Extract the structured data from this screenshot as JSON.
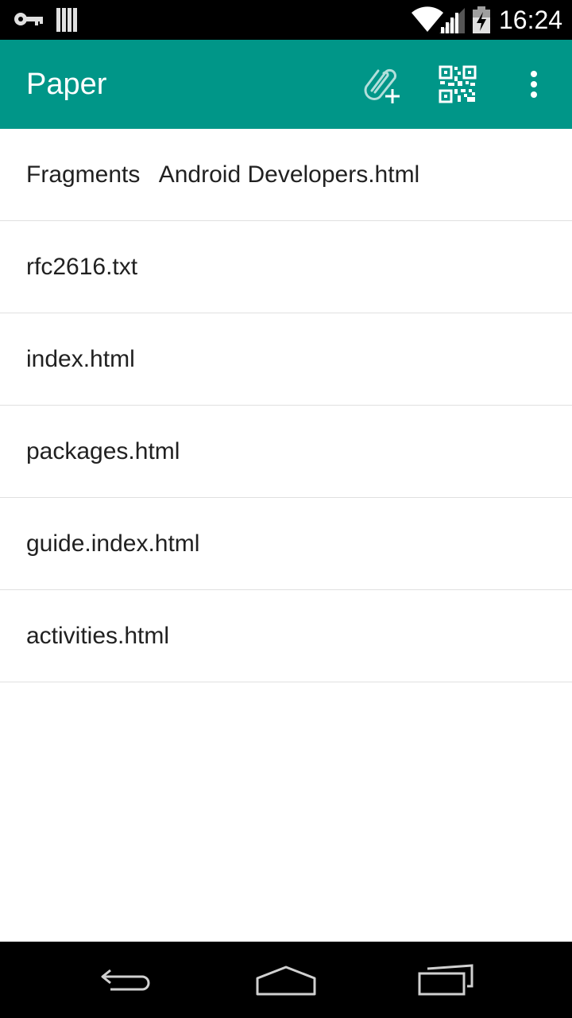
{
  "status_bar": {
    "time": "16:24",
    "icons": [
      "vpn-key-icon",
      "storage-bars-icon",
      "wifi-icon",
      "cell-signal-icon",
      "battery-charging-icon"
    ]
  },
  "app_bar": {
    "title": "Paper",
    "background_color": "#009688",
    "actions": [
      "attach-add-icon",
      "qr-code-icon",
      "overflow-menu-icon"
    ]
  },
  "files": [
    {
      "name": "Fragments   Android Developers.html"
    },
    {
      "name": "rfc2616.txt"
    },
    {
      "name": "index.html"
    },
    {
      "name": "packages.html"
    },
    {
      "name": "guide.index.html"
    },
    {
      "name": "activities.html"
    }
  ],
  "nav_bar": {
    "buttons": [
      "back-icon",
      "home-icon",
      "recents-icon"
    ]
  }
}
